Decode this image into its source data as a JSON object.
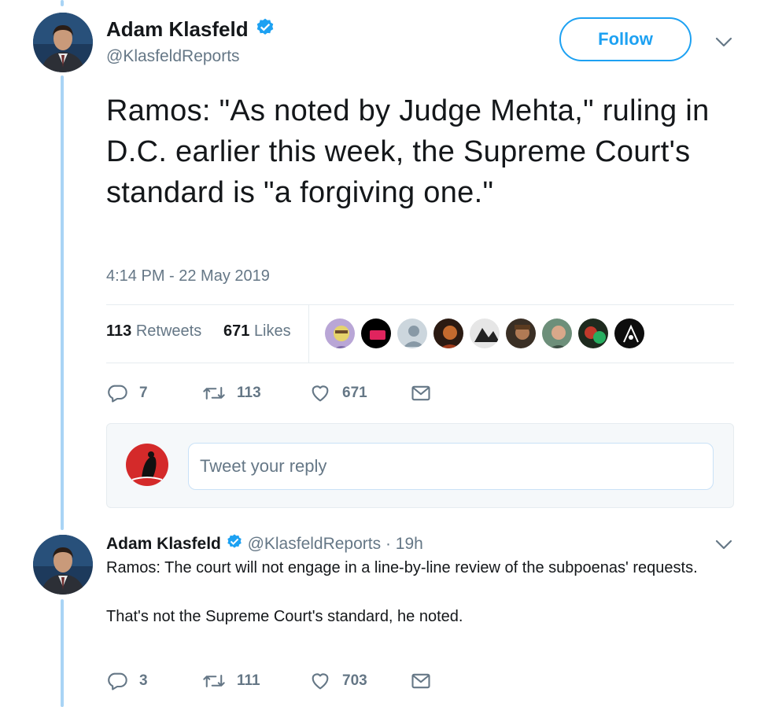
{
  "main_tweet": {
    "author_name": "Adam Klasfeld",
    "author_handle": "@KlasfeldReports",
    "follow_label": "Follow",
    "text": "Ramos: \"As noted by Judge Mehta,\" ruling in D.C. earlier this week, the Supreme Court's standard is \"a forgiving one.\"",
    "timestamp": "4:14 PM - 22 May 2019",
    "retweets_count": "113",
    "retweets_label": "Retweets",
    "likes_count": "671",
    "likes_label": "Likes",
    "actions": {
      "replies": "7",
      "retweets": "113",
      "likes": "671"
    }
  },
  "reply_box": {
    "placeholder": "Tweet your reply"
  },
  "reply_tweet": {
    "author_name": "Adam Klasfeld",
    "author_handle": "@KlasfeldReports",
    "time": "· 19h",
    "text_p1": "Ramos: The court will not engage in a line-by-line review of the subpoenas' requests.",
    "text_p2": "That's not the Supreme Court's standard, he noted.",
    "actions": {
      "replies": "3",
      "retweets": "111",
      "likes": "703"
    }
  },
  "colors": {
    "accent": "#1da1f2",
    "thread_line": "#a9d4f5",
    "muted_text": "#657786",
    "primary_text": "#14171a"
  },
  "icons": {
    "verified": "verified-badge-icon",
    "caret": "chevron-down-icon",
    "reply": "reply-bubble-icon",
    "retweet": "retweet-icon",
    "like": "heart-icon",
    "dm": "envelope-icon"
  }
}
